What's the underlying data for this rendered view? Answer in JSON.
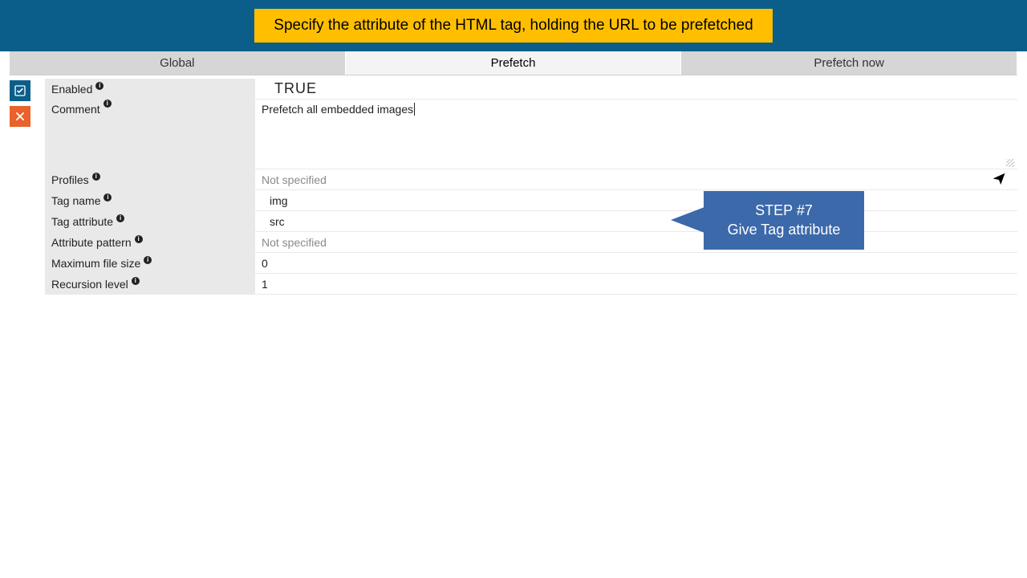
{
  "banner": {
    "text": "Specify the attribute of the HTML tag, holding the URL to be prefetched"
  },
  "tabs": [
    {
      "label": "Global",
      "active": false
    },
    {
      "label": "Prefetch",
      "active": true
    },
    {
      "label": "Prefetch now",
      "active": false
    }
  ],
  "side": {
    "ok_title": "Apply",
    "cancel_title": "Cancel"
  },
  "fields": {
    "enabled": {
      "label": "Enabled",
      "value": "TRUE"
    },
    "comment": {
      "label": "Comment",
      "value": "Prefetch all embedded images"
    },
    "profiles": {
      "label": "Profiles",
      "value": "Not specified"
    },
    "tag_name": {
      "label": "Tag name",
      "value": "img"
    },
    "tag_attr": {
      "label": "Tag attribute",
      "value": "src"
    },
    "attr_pat": {
      "label": "Attribute pattern",
      "value": "Not specified"
    },
    "max_size": {
      "label": "Maximum file size",
      "value": "0"
    },
    "recursion": {
      "label": "Recursion level",
      "value": "1"
    }
  },
  "callout": {
    "line1": "STEP #7",
    "line2": "Give Tag attribute"
  }
}
